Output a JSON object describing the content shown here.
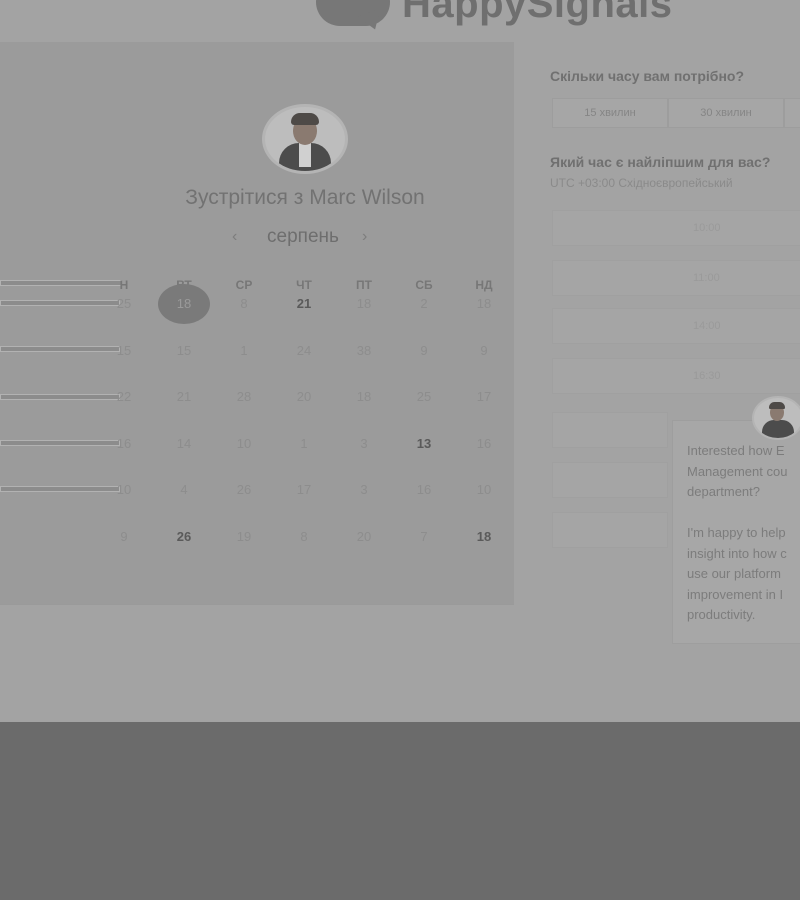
{
  "brand": {
    "logo_text": "HappySignals"
  },
  "calendar": {
    "title": "Зустрітися з Marc Wilson",
    "month": "серпень",
    "prev": "‹",
    "next": "›",
    "weekdays": [
      "Н",
      "ВТ",
      "СР",
      "ЧТ",
      "ПТ",
      "СБ",
      "НД"
    ],
    "weeks": [
      [
        "25",
        "18",
        "8",
        "21",
        "18",
        "2",
        "18"
      ],
      [
        "15",
        "15",
        "1",
        "24",
        "38",
        "9",
        "9"
      ],
      [
        "22",
        "21",
        "28",
        "20",
        "18",
        "25",
        "17"
      ],
      [
        "16",
        "14",
        "10",
        "1",
        "3",
        "13",
        "16"
      ],
      [
        "10",
        "4",
        "26",
        "17",
        "3",
        "16",
        "10"
      ],
      [
        "9",
        "26",
        "19",
        "8",
        "20",
        "7",
        "18"
      ]
    ]
  },
  "duration": {
    "question": "Скільки часу вам потрібно?",
    "options": [
      "15 хвилин",
      "30 хвилин"
    ]
  },
  "time": {
    "question": "Який час є найліпшим для вас?",
    "timezone": "UTC +03:00 Східноєвропейський",
    "slots": [
      "10:00",
      "11:00",
      "14:00",
      "16:30"
    ]
  },
  "chat": {
    "message_1": "Interested how E\nManagement cou\ndepartment?",
    "message_2": "I'm happy to help\ninsight into how c\nuse our platform\nimprovement in I\nproductivity."
  }
}
